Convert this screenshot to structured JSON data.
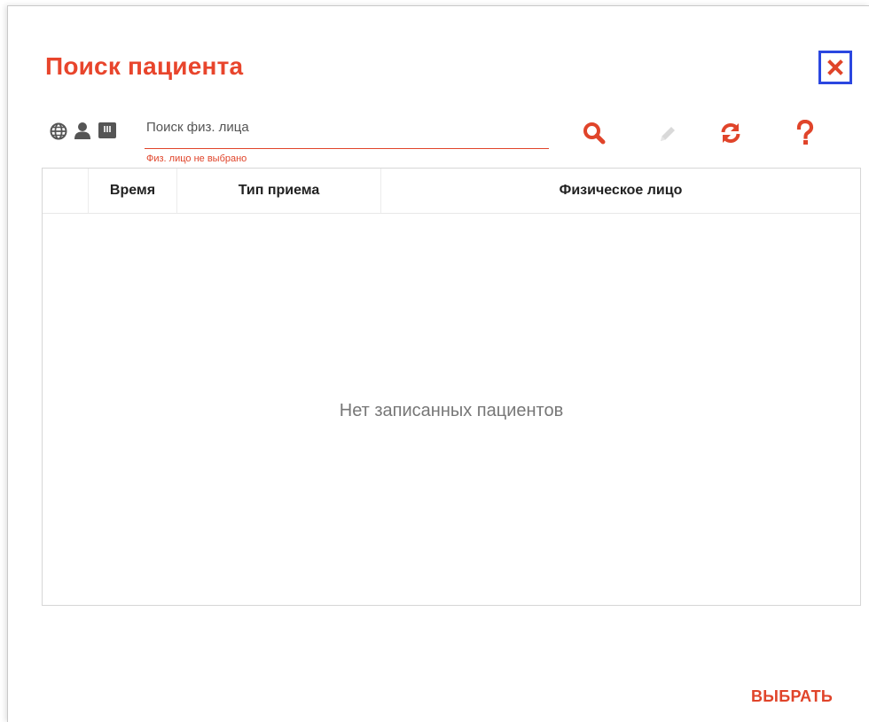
{
  "dialog": {
    "title": "Поиск пациента",
    "close_icon": "close-icon"
  },
  "toolbar": {
    "icons": [
      "globe-icon",
      "person-icon",
      "id-card-icon"
    ],
    "search_placeholder": "Поиск физ. лица",
    "search_value": "",
    "hint": "Физ. лицо не выбрано",
    "actions": [
      "search-icon",
      "edit-icon",
      "refresh-icon",
      "help-icon"
    ]
  },
  "table": {
    "columns": [
      "",
      "Время",
      "Тип приема",
      "Физическое лицо"
    ],
    "empty_message": "Нет записанных пациентов"
  },
  "footer": {
    "select_label": "ВЫБРАТЬ"
  },
  "colors": {
    "accent": "#e8452c",
    "focus_border": "#2b47e0",
    "icon_gray": "#555555",
    "disabled_icon": "#d9d9d9"
  }
}
